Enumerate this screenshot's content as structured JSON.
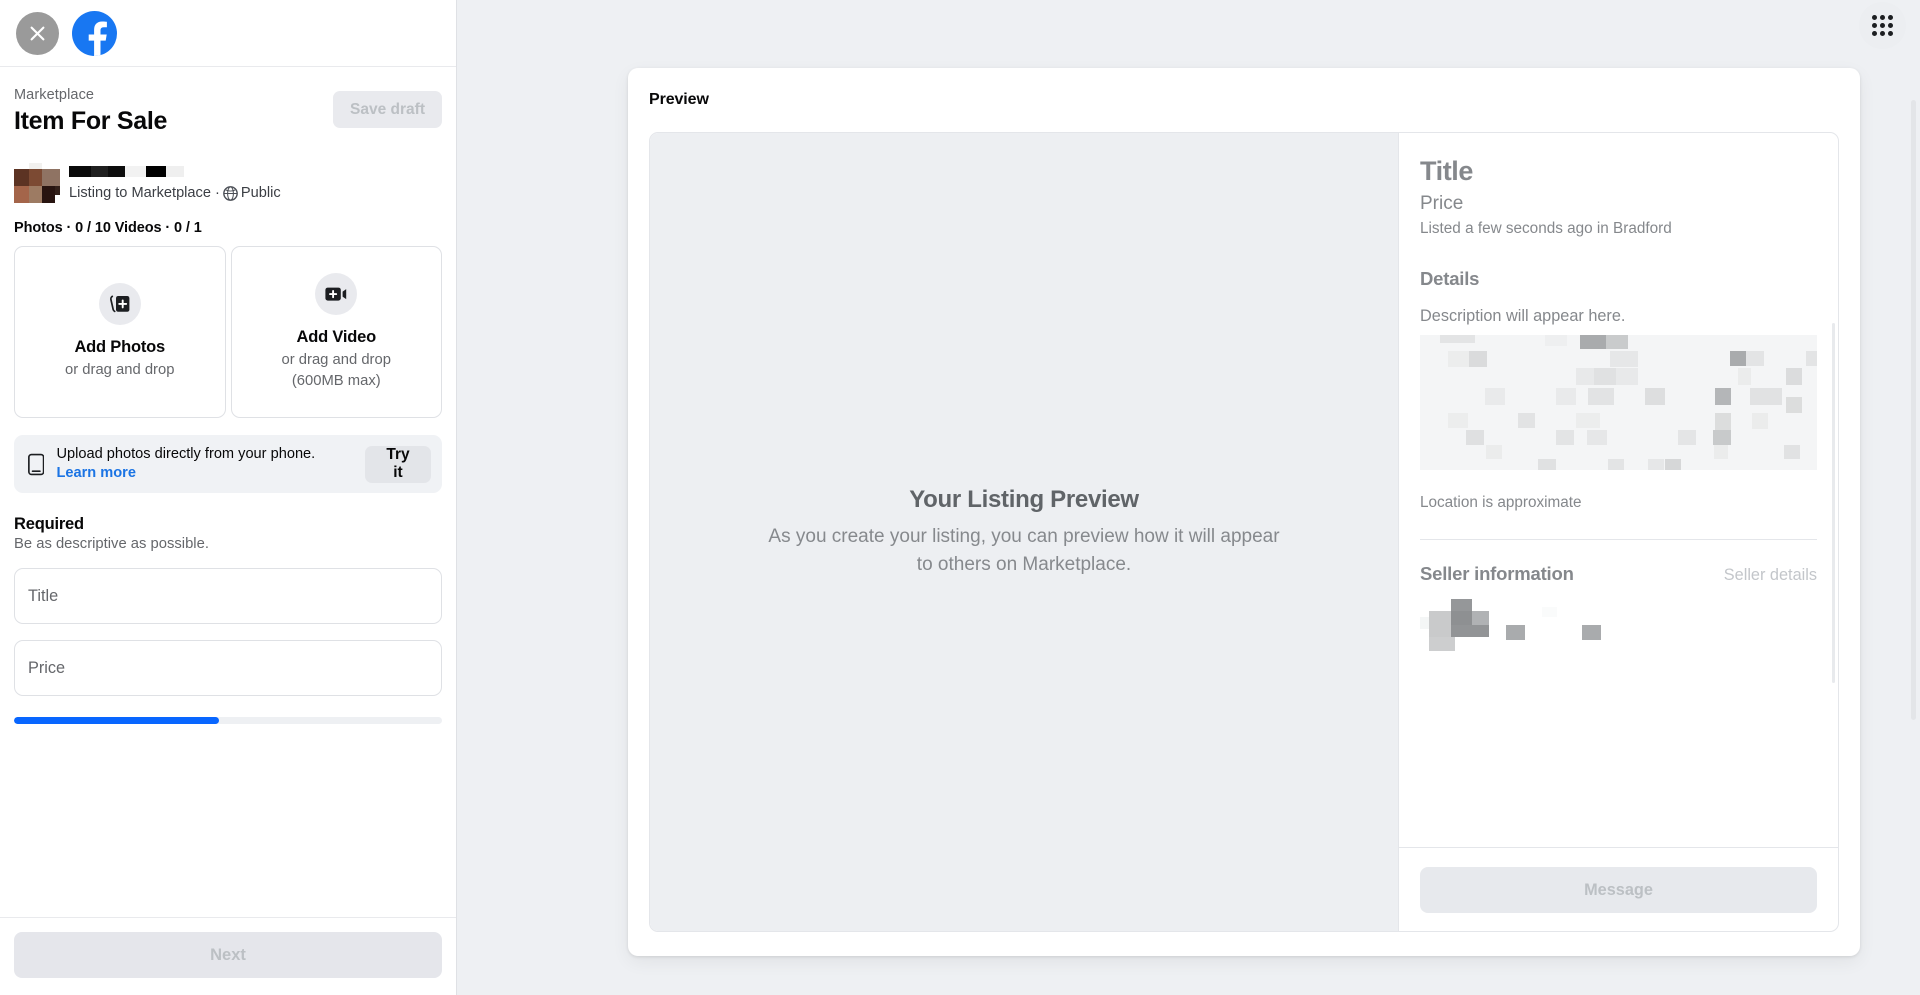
{
  "window": {
    "background": "#eef0f3"
  },
  "composer": {
    "close_icon": "close-icon",
    "brand_icon": "facebook-logo-icon",
    "breadcrumb": "Marketplace",
    "title": "Item For Sale",
    "save_draft_label": "Save draft",
    "audience": {
      "listing_text": "Listing to Marketplace ·",
      "privacy_label": "Public",
      "privacy_icon": "globe-icon",
      "avatar": "avatar"
    },
    "media_counts": "Photos · 0 / 10 Videos · 0 / 1",
    "media_tiles": [
      {
        "icon": "add-photos-icon",
        "title": "Add Photos",
        "sub": "or drag and drop",
        "sub2": ""
      },
      {
        "icon": "add-video-icon",
        "title": "Add Video",
        "sub": "or drag and drop",
        "sub2": "(600MB max)"
      }
    ],
    "phone_banner": {
      "icon": "mobile-phone-icon",
      "text": "Upload photos directly from your phone.",
      "link_label": "Learn more",
      "button_label": "Try it"
    },
    "required": {
      "heading": "Required",
      "subheading": "Be as descriptive as possible."
    },
    "fields": [
      {
        "name": "title-field",
        "placeholder": "Title",
        "value": ""
      },
      {
        "name": "price-field",
        "placeholder": "Price",
        "value": ""
      }
    ],
    "progress": {
      "percent": 48,
      "fill_color": "#0866ff",
      "track_color": "#eef0f3"
    },
    "next_label": "Next"
  },
  "topbar": {
    "grid_icon": "app-grid-icon"
  },
  "preview": {
    "header_label": "Preview",
    "placeholder": {
      "title": "Your Listing Preview",
      "subtitle": "As you create your listing, you can preview how it will appear to others on Marketplace."
    },
    "detail": {
      "title": "Title",
      "price": "Price",
      "listed": "Listed a few seconds ago in Bradford",
      "details_heading": "Details",
      "description": "Description will appear here.",
      "map_caption": "Location is approximate",
      "seller_heading": "Seller information",
      "seller_details_link": "Seller details",
      "message_label": "Message"
    }
  }
}
